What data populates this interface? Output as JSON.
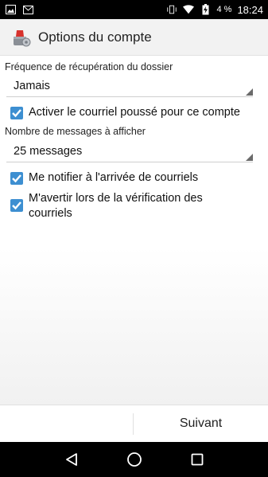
{
  "status_bar": {
    "battery_percent": "4 %",
    "time": "18:24",
    "icons": [
      "image-icon",
      "mail-icon",
      "vibrate-icon",
      "wifi-icon",
      "battery-charging-icon"
    ]
  },
  "header": {
    "title": "Options du compte",
    "icon": "account-settings-icon"
  },
  "form": {
    "frequency": {
      "label": "Fréquence de récupération du dossier",
      "value": "Jamais"
    },
    "push": {
      "label": "Activer le courriel poussé pour ce compte",
      "checked": true
    },
    "messages_count": {
      "label": "Nombre de messages à afficher",
      "value": "25 messages"
    },
    "notify": {
      "label": "Me notifier à l'arrivée de courriels",
      "checked": true
    },
    "warn": {
      "label": "M'avertir lors de la vérification des courriels",
      "checked": true
    }
  },
  "footer": {
    "next_label": "Suivant"
  },
  "colors": {
    "checkbox_accent": "#3d8fd1",
    "status_bar": "#000000",
    "action_bar": "#f2f2f2"
  }
}
